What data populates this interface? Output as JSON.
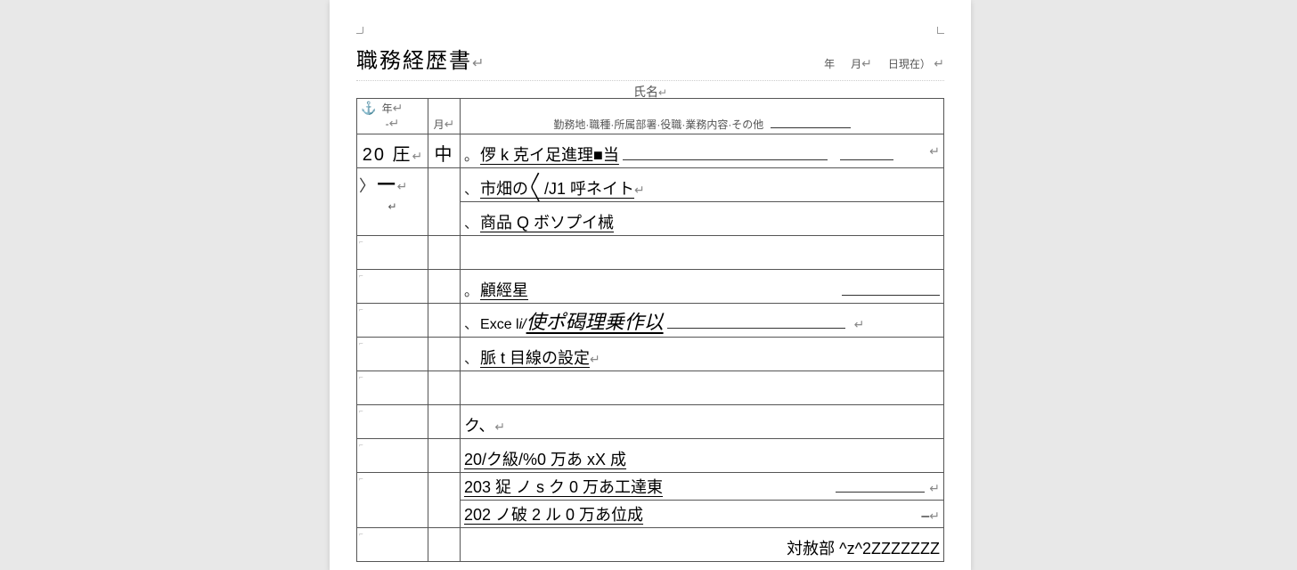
{
  "title": "職務経歴書",
  "date": {
    "year": "年",
    "month": "月",
    "suffix": "日現在）"
  },
  "name_label": "氏名",
  "headers": {
    "year": "年",
    "dash": "-",
    "month": "月",
    "desc": "勤務地·職種·所属部署·役職·業務内容·その他"
  },
  "row2": {
    "year": "20 圧",
    "month": "中"
  },
  "row3": {
    "year": "一"
  },
  "rows": [
    {
      "prefix": "。",
      "text": "㑩 k 克イ足進理■当",
      "trail": "long+short",
      "enter": true
    },
    {
      "prefix": "、",
      "text": "市畑の〱/J1 呼ネイト",
      "enter": true,
      "under": true
    },
    {
      "prefix": "、",
      "text": "商品 Q ボソプイ械",
      "under": true
    },
    {
      "text": ""
    },
    {
      "prefix": "。",
      "text": "顧經星",
      "under": true,
      "trail": "right"
    },
    {
      "prefix": "、",
      "pre": "Exce l",
      "ital": " i/",
      "text": "使ポ碣理乗作以",
      "under": true,
      "trail": "mid",
      "enter": true,
      "italic": true
    },
    {
      "prefix": "、",
      "text": "脈 t 目線の設定",
      "under": true,
      "enter": true
    },
    {
      "text": ""
    },
    {
      "text": "ク、",
      "enter": true
    },
    {
      "text": "20/ク級/%0 万あ xX 成",
      "under": true
    },
    {
      "text": "203 㹱  ノ s ク 0 万あ工達東",
      "under": true,
      "trail": "right",
      "enter": true
    },
    {
      "text": "202 ノ破 2 ル 0 万あ位成",
      "under": true,
      "trail_dash": true
    },
    {
      "right": "対赦部  ^z^2ZZZZZZZ"
    }
  ]
}
